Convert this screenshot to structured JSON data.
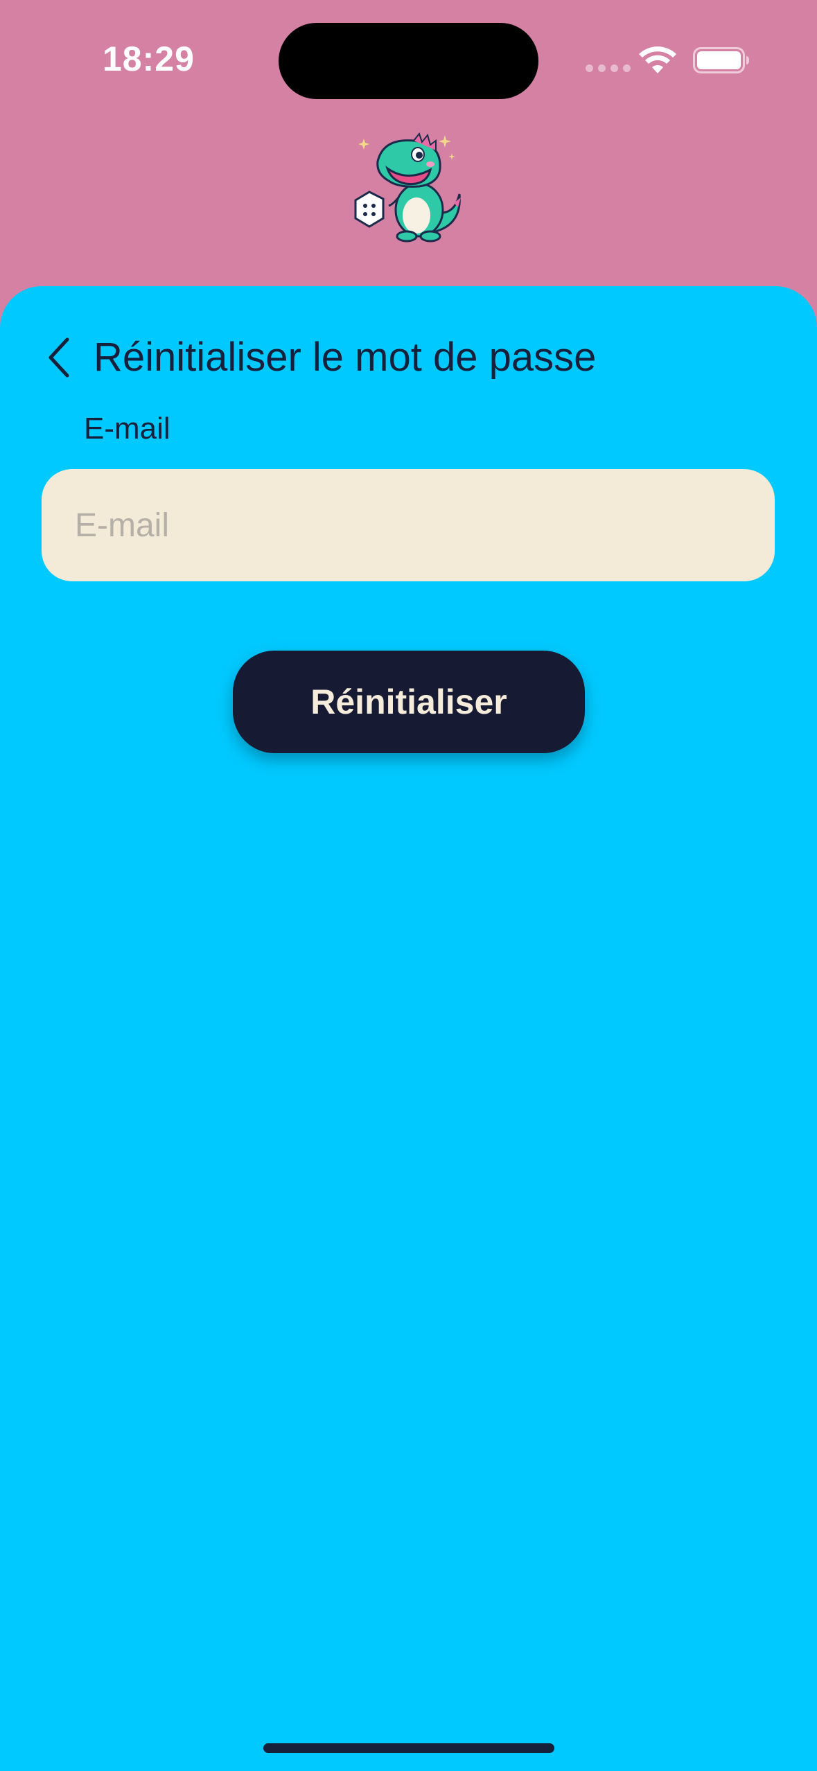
{
  "status_bar": {
    "time": "18:29"
  },
  "header": {
    "logo_icon": "dinosaur-with-dice-logo"
  },
  "form": {
    "back_icon": "chevron-left-icon",
    "title": "Réinitialiser le mot de passe",
    "email_label": "E-mail",
    "email_placeholder": "E-mail",
    "email_value": "",
    "submit_label": "Réinitialiser"
  },
  "colors": {
    "header_background": "#d481a4",
    "sheet_background": "#00c9ff",
    "input_background": "#f3ead7",
    "button_background": "#161a33",
    "button_text": "#f6ecdc",
    "text_primary": "#17203a"
  }
}
